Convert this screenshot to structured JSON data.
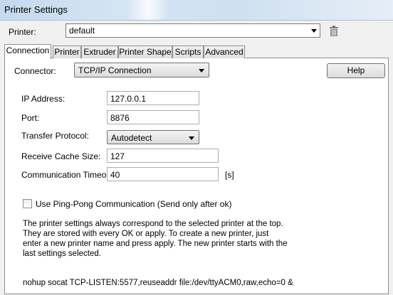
{
  "window": {
    "title": "Printer Settings"
  },
  "printer": {
    "label": "Printer:",
    "value": "default",
    "delete_icon": "trash-icon"
  },
  "tabs": [
    {
      "label": "Connection",
      "active": true
    },
    {
      "label": "Printer",
      "active": false
    },
    {
      "label": "Extruder",
      "active": false
    },
    {
      "label": "Printer Shape",
      "active": false
    },
    {
      "label": "Scripts",
      "active": false
    },
    {
      "label": "Advanced",
      "active": false
    }
  ],
  "connection": {
    "connector_label": "Connector:",
    "connector_value": "TCP/IP Connection",
    "help_label": "Help",
    "ip_label": "IP Address:",
    "ip_value": "127.0.0.1",
    "port_label": "Port:",
    "port_value": "8876",
    "protocol_label": "Transfer Protocol:",
    "protocol_value": "Autodetect",
    "cache_label": "Receive Cache Size:",
    "cache_value": "127",
    "timeout_label": "Communication Timeout:",
    "timeout_value": "40",
    "timeout_unit": "[s]",
    "pingpong_label": "Use Ping-Pong Communication (Send only after ok)",
    "pingpong_checked": false,
    "info_text": "The printer settings always correspond to the selected printer at the top. They are stored with every OK or apply. To create a new printer, just enter a new printer name and press apply. The new printer starts with the last settings selected.",
    "command_text": "nohup socat TCP-LISTEN:5577,reuseaddr file:/dev/ttyACM0,raw,echo=0 &"
  }
}
